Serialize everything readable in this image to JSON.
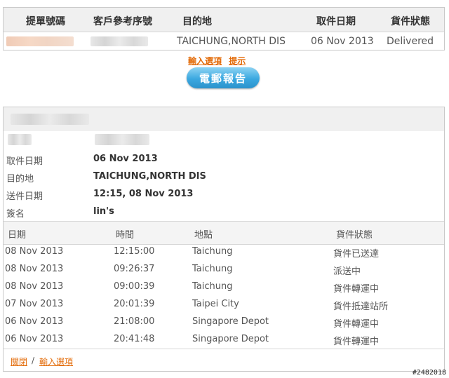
{
  "summary": {
    "headers": [
      "提單號碼",
      "客戶參考序號",
      "目的地",
      "取件日期",
      "貨件狀態"
    ],
    "row": {
      "destination": "TAICHUNG,NORTH DIS",
      "pickup_date": "06 Nov 2013",
      "status": "Delivered"
    }
  },
  "top_links": {
    "input_options": "輸入選項",
    "tips": "提示"
  },
  "email_button": "電郵報告",
  "details": {
    "fields": [
      {
        "label": "取件日期",
        "value": "06 Nov 2013"
      },
      {
        "label": "目的地",
        "value": "TAICHUNG,NORTH DIS"
      },
      {
        "label": "送件日期",
        "value": "12:15, 08 Nov 2013"
      },
      {
        "label": "簽名",
        "value": "lin's"
      }
    ],
    "event_headers": [
      "日期",
      "時間",
      "地點",
      "貨件狀態"
    ],
    "events": [
      {
        "date": "08 Nov 2013",
        "time": "12:15:00",
        "location": "Taichung",
        "status": "貨件已送達"
      },
      {
        "date": "08 Nov 2013",
        "time": "09:26:37",
        "location": "Taichung",
        "status": "派送中"
      },
      {
        "date": "08 Nov 2013",
        "time": "09:00:39",
        "location": "Taichung",
        "status": "貨件轉運中"
      },
      {
        "date": "07 Nov 2013",
        "time": "20:01:39",
        "location": "Taipei City",
        "status": "貨件抵達站所"
      },
      {
        "date": "06 Nov 2013",
        "time": "21:08:00",
        "location": "Singapore Depot",
        "status": "貨件轉運中"
      },
      {
        "date": "06 Nov 2013",
        "time": "20:41:48",
        "location": "Singapore Depot",
        "status": "貨件轉運中"
      }
    ],
    "footer": {
      "close": "關閉",
      "separator": "/",
      "input_options": "輸入選項"
    }
  },
  "watermark": "#2482018"
}
